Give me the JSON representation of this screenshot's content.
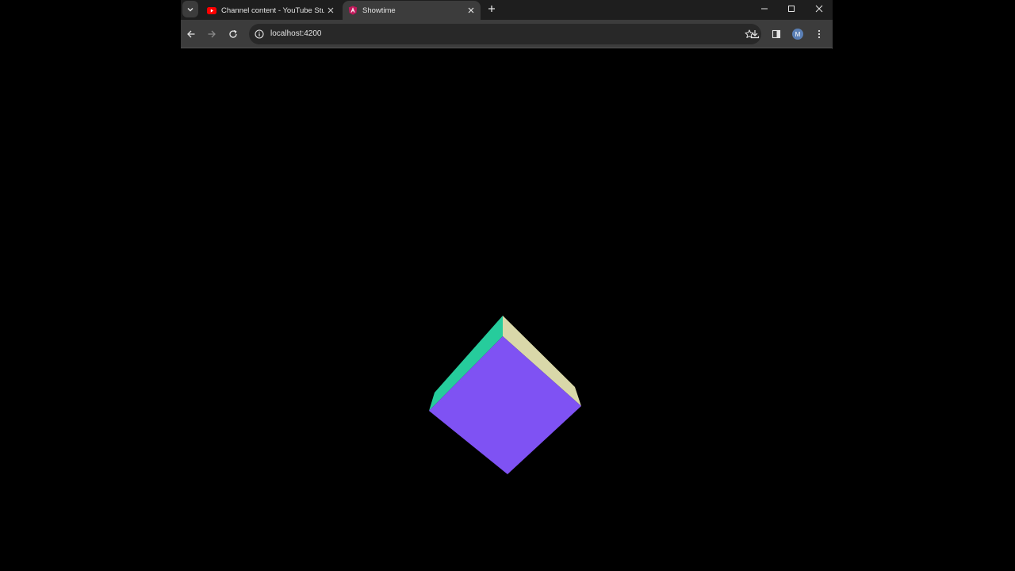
{
  "browser": {
    "tabs": [
      {
        "title": "Channel content - YouTube Studio",
        "icon": "youtube-icon",
        "active": false
      },
      {
        "title": "Showtime",
        "icon": "angular-icon",
        "active": true
      }
    ],
    "address_bar": {
      "url": "localhost:4200"
    },
    "profile_initial": "M"
  },
  "scene": {
    "object": "cube",
    "colors": {
      "front": "#7f52f3",
      "left": "#26cc9c",
      "right": "#d9d8a9",
      "background": "#000000"
    }
  },
  "theme": {
    "titlebar": "#1e1e1e",
    "toolbar": "#3c3c3c",
    "omnibox": "#282828",
    "text": "#e3e3e3"
  }
}
